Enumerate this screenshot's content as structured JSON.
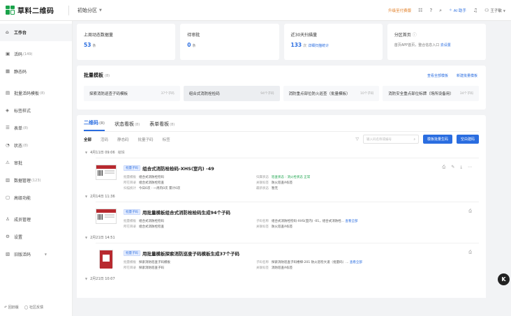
{
  "app": {
    "name": "草料二维码",
    "workspace": "初始分区"
  },
  "top_right": {
    "upgrade": "升级至付费版",
    "ai_help": "AI 助手",
    "user": "王子敏"
  },
  "sidebar": {
    "items": [
      {
        "icon": "home-icon",
        "label": "工作台",
        "count": ""
      },
      {
        "icon": "qrcode-icon",
        "label": "活码",
        "count": "(149)"
      },
      {
        "icon": "static-code-icon",
        "label": "静态码",
        "count": ""
      },
      {
        "icon": "batch-icon",
        "label": "批量活码模板",
        "count": "(8)"
      },
      {
        "icon": "style-icon",
        "label": "标签样式",
        "count": ""
      },
      {
        "icon": "form-icon",
        "label": "表单",
        "count": "(8)"
      },
      {
        "icon": "status-icon",
        "label": "状态",
        "count": "(8)"
      },
      {
        "icon": "audit-icon",
        "label": "审批",
        "count": ""
      },
      {
        "icon": "data-icon",
        "label": "数据管理",
        "count": "(123)"
      },
      {
        "icon": "advanced-icon",
        "label": "高级功能",
        "count": ""
      },
      {
        "icon": "members-icon",
        "label": "成员管理",
        "count": ""
      },
      {
        "icon": "settings-icon",
        "label": "设置",
        "count": ""
      },
      {
        "icon": "old-code-icon",
        "label": "旧版活码",
        "count": ""
      }
    ],
    "bottom": {
      "back": "回旧版",
      "feedback": "社区反馈"
    }
  },
  "stats": [
    {
      "label": "上周动态数据量",
      "value": "53",
      "unit": "条"
    },
    {
      "label": "待审批",
      "value": "0",
      "unit": "条"
    },
    {
      "label": "近30天扫描量",
      "value": "133",
      "unit": "次",
      "link": "详细扫描统计"
    },
    {
      "label": "分区首页",
      "desc": "首页APP首页，整合信息入口",
      "link": "去设置"
    }
  ],
  "batch": {
    "title": "批量模板",
    "count": "(8)",
    "link_all": "查看全部模板",
    "link_new": "新建批量模板",
    "templates": [
      {
        "name": "探索消防巡查子码模板",
        "n": "37个子码"
      },
      {
        "name": "组合式消防栓检码",
        "n": "94个子码"
      },
      {
        "name": "消防重点部位防火巡查（批量模板）",
        "n": "10个子码"
      },
      {
        "name": "消防安全重点部位标牌（场所设备用）",
        "n": "34个子码"
      }
    ]
  },
  "codes": {
    "tabs": [
      {
        "label": "二维码",
        "count": "(8)"
      },
      {
        "label": "状态看板",
        "count": "(8)"
      },
      {
        "label": "表单看板",
        "count": "(8)"
      }
    ],
    "filters": [
      "全部",
      "活码",
      "静态码",
      "批量子码",
      "标签"
    ],
    "search_placeholder": "输入码名称或编号",
    "btn_batch": "模板批量生码",
    "btn_new": "空白建码",
    "groups": [
      {
        "date": "4月11日 09:06",
        "status": "编辑",
        "tag": "批量子码",
        "title": "组合式消防栓检码-XHS(室内) -49",
        "rows": [
          [
            [
              "批量模板",
              "组合式消防栓检码"
            ],
            [
              "归属状态",
              "巡查状态 : 消火栓状态 正常"
            ]
          ],
          [
            [
              "所在目录",
              "组合式消防栓检查"
            ],
            [
              "关联标签",
              "防火巡查A标签"
            ]
          ],
          [
            [
              "扫描统计",
              "今日0次 · 一周内0次 累计0次"
            ],
            [
              "最新状态",
              "暂无"
            ]
          ]
        ]
      },
      {
        "date": "2月14日 11:36",
        "status": "",
        "tag": "批量子码",
        "title": "用批量模板组合式消防栓检码生成94个子码",
        "rows": [
          [
            [
              "批量模板",
              "组合式消防栓检码"
            ],
            [
              "子码名称",
              "组合式消防栓检码-XHS(室内) -01，组合式消防栓..."
            ]
          ],
          [
            [
              "所在目录",
              "组合式消防栓检查"
            ],
            [
              "关联标签",
              "防火巡查A标签"
            ]
          ]
        ],
        "view": "查看全部"
      },
      {
        "date": "2月21日 14:51",
        "status": "",
        "tag": "批量子码",
        "title": "用批量模板探索消防巡查子码模板生成37个子码",
        "rows": [
          [
            [
              "批量模板",
              "探索消防巡查子码模板"
            ],
            [
              "子码名称",
              "探索消防巡查子码楼梯-201 防火巡检大道（批量码）..."
            ]
          ],
          [
            [
              "所在目录",
              "探索消防巡查子码"
            ],
            [
              "关联标签",
              "消防巡查A标签"
            ]
          ]
        ],
        "view": "查看全部"
      },
      {
        "date": "2月21日 10:07",
        "status": ""
      }
    ]
  }
}
